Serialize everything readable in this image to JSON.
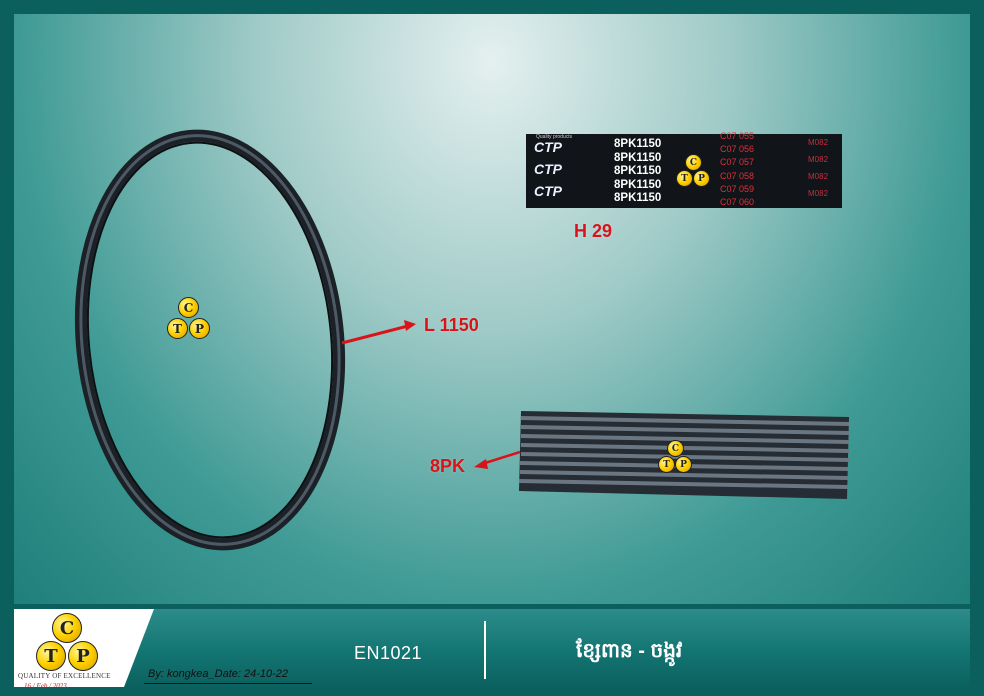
{
  "callouts": {
    "length": "L 1150",
    "height": "H 29",
    "ribs": "8PK"
  },
  "belt_label": {
    "brand": "CTP",
    "tagline": "Quality products",
    "part_rows": [
      "8PK1150",
      "8PK1150",
      "8PK1150",
      "8PK1150",
      "8PK1150"
    ],
    "batch_rows": [
      "C07 055",
      "C07 056",
      "C07 057",
      "C07 058",
      "C07 059",
      "C07 060"
    ],
    "model_rows": [
      "M082",
      "M082",
      "M082",
      "M082"
    ]
  },
  "watermark": {
    "letters": [
      "C",
      "T",
      "P"
    ]
  },
  "footer": {
    "logo_letters": [
      "C",
      "T",
      "P"
    ],
    "quality": "QUALITY OF EXCELLENCE",
    "stamp": "16 / Feb / 2023",
    "by": "By: kongkea_Date: 24-10-22",
    "code": "EN1021",
    "name": "ខ្សែពាន - ចង្កូវ"
  },
  "colors": {
    "callout": "#d8141a",
    "belt": "#1a1f24",
    "logo_gold": "#ffd200"
  }
}
